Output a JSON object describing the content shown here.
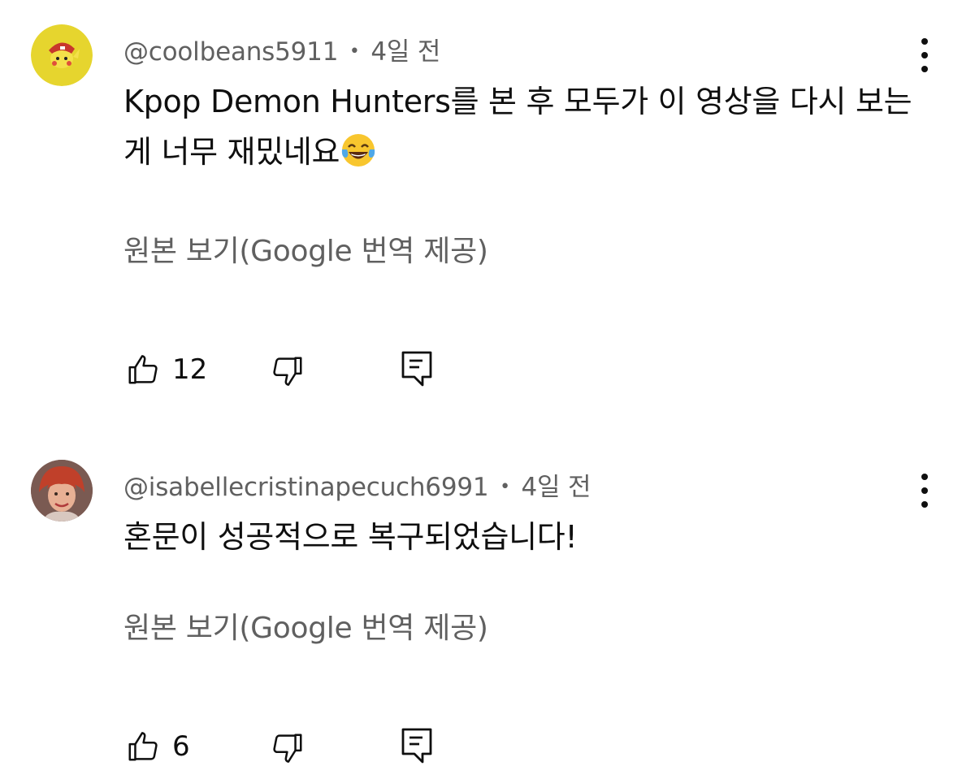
{
  "comments": [
    {
      "author": "@coolbeans5911",
      "separator": "•",
      "time": "4일 전",
      "text": "Kpop Demon Hunters를 본 후 모두가 이 영상을 다시 보는 게 너무 재밌네요",
      "emoji": "face-with-tears-of-joy",
      "translate_link": "원본 보기(Google 번역 제공)",
      "likes": "12",
      "avatar_colors": {
        "bg": "#e6d52e",
        "accent": "#c8372c"
      }
    },
    {
      "author": "@isabellecristinapecuch6991",
      "separator": "•",
      "time": "4일 전",
      "text": "혼문이 성공적으로 복구되었습니다!",
      "translate_link": "원본 보기(Google 번역 제공)",
      "likes": "6",
      "avatar_colors": {
        "hair": "#c0402a",
        "skin": "#e8b094"
      }
    }
  ],
  "icons": [
    "thumb-up-icon",
    "thumb-down-icon",
    "reply-icon",
    "more-vert-icon"
  ],
  "colors": {
    "text": "#0f0f0f",
    "secondary": "#606060",
    "background": "#ffffff"
  }
}
